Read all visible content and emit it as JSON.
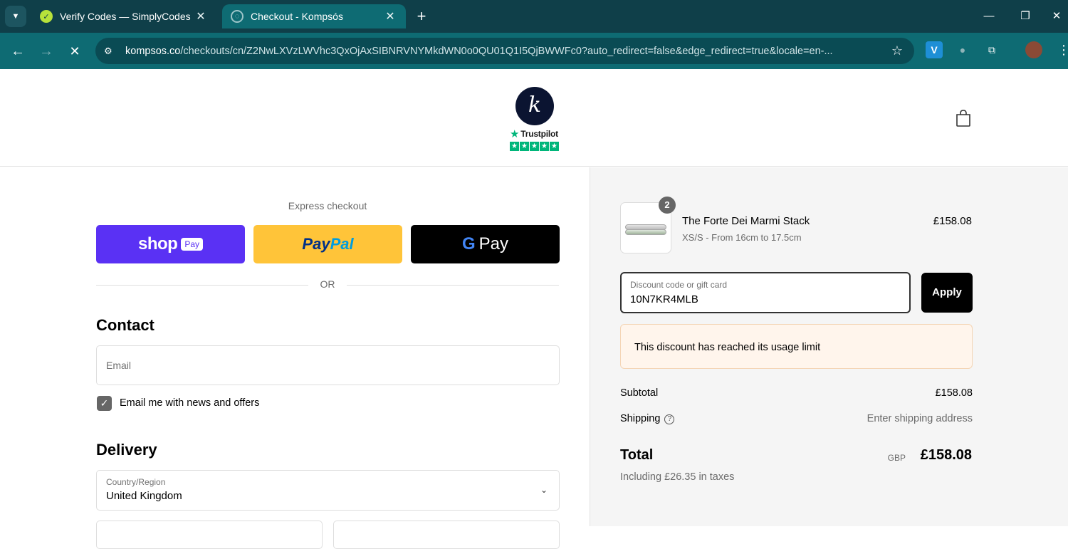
{
  "browser": {
    "tabs": [
      {
        "title": "Verify Codes — SimplyCodes",
        "active": false
      },
      {
        "title": "Checkout - Kompsós",
        "active": true
      }
    ],
    "url_host": "kompsos.co",
    "url_path": "/checkouts/cn/Z2NwLXVzLWVhc3QxOjAxSIBNRVNYMkdWN0o0QU01Q1I5QjBWWFc0?auto_redirect=false&edge_redirect=true&locale=en-...",
    "colors": {
      "tabbar": "#0f3f49",
      "toolbar": "#0e6b73"
    }
  },
  "header": {
    "logo_letter": "k",
    "trustpilot_label": "Trustpilot"
  },
  "express": {
    "label": "Express checkout",
    "shop_label": "shop",
    "shop_pay_pill": "Pay",
    "paypal_part1": "Pay",
    "paypal_part2": "Pal",
    "gpay_g": "G",
    "gpay_label": "Pay",
    "or_label": "OR"
  },
  "contact": {
    "title": "Contact",
    "email_placeholder": "Email",
    "newsletter_label": "Email me with news and offers",
    "newsletter_checked": true
  },
  "delivery": {
    "title": "Delivery",
    "country_label": "Country/Region",
    "country_value": "United Kingdom"
  },
  "order": {
    "item": {
      "quantity": "2",
      "name": "The Forte Dei Marmi Stack",
      "variant": "XS/S - From 16cm to 17.5cm",
      "price": "£158.08"
    },
    "discount": {
      "label": "Discount code or gift card",
      "value": "10N7KR4MLB",
      "apply_label": "Apply",
      "error": "This discount has reached its usage limit"
    },
    "subtotal_label": "Subtotal",
    "subtotal_value": "£158.08",
    "shipping_label": "Shipping",
    "shipping_value": "Enter shipping address",
    "total_label": "Total",
    "currency": "GBP",
    "total_value": "£158.08",
    "taxes_note": "Including £26.35 in taxes"
  }
}
